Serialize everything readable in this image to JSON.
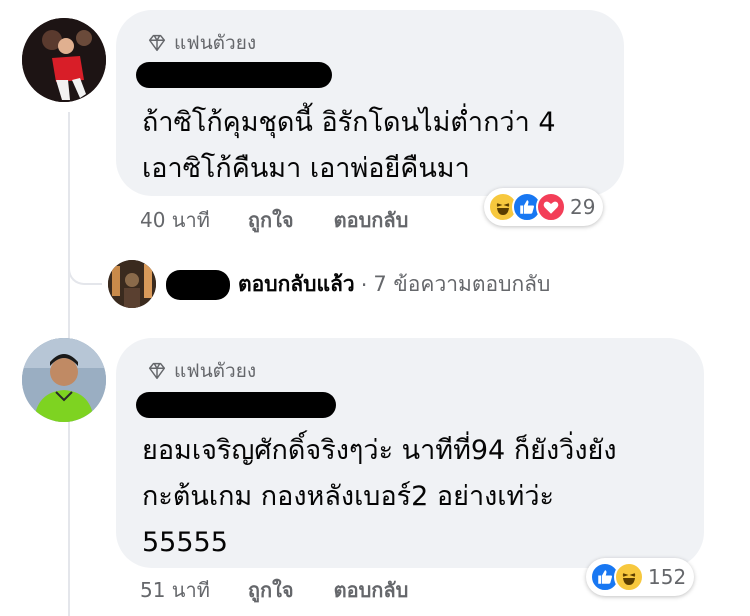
{
  "colors": {
    "bubble": "#f0f2f5",
    "meta_text": "#65676b",
    "like_blue": "#1877f2",
    "love_red": "#f33e58",
    "haha_yellow": "#f7c83e"
  },
  "comments": [
    {
      "badge": "แฟนตัวยง",
      "author": "",
      "lines": [
        "ถ้าซิโก้คุมชุดนี้ อิรักโดนไม่ต่ำกว่า 4",
        "เอาซิโก้คืนมา เอาพ่อยีคืนมา"
      ],
      "time": "40 นาที",
      "like_label": "ถูกใจ",
      "reply_label": "ตอบกลับ",
      "reactions": [
        "haha-icon",
        "like-icon",
        "love-icon"
      ],
      "reaction_count": "29"
    },
    {
      "badge": "แฟนตัวยง",
      "author": "",
      "lines": [
        "ยอมเจริญศักดิ์จริงๆว่ะ นาทีที่94 ก็ยังวิ่งยัง",
        "กะต้นเกม กองหลังเบอร์2 อย่างเท่ว่ะ",
        "55555"
      ],
      "time": "51 นาที",
      "like_label": "ถูกใจ",
      "reply_label": "ตอบกลับ",
      "reactions": [
        "like-icon",
        "haha-icon"
      ],
      "reaction_count": "152"
    }
  ],
  "reply_summary": {
    "replied_label": "ตอบกลับแล้ว",
    "separator": "·",
    "more_replies": "7 ข้อความตอบกลับ"
  }
}
